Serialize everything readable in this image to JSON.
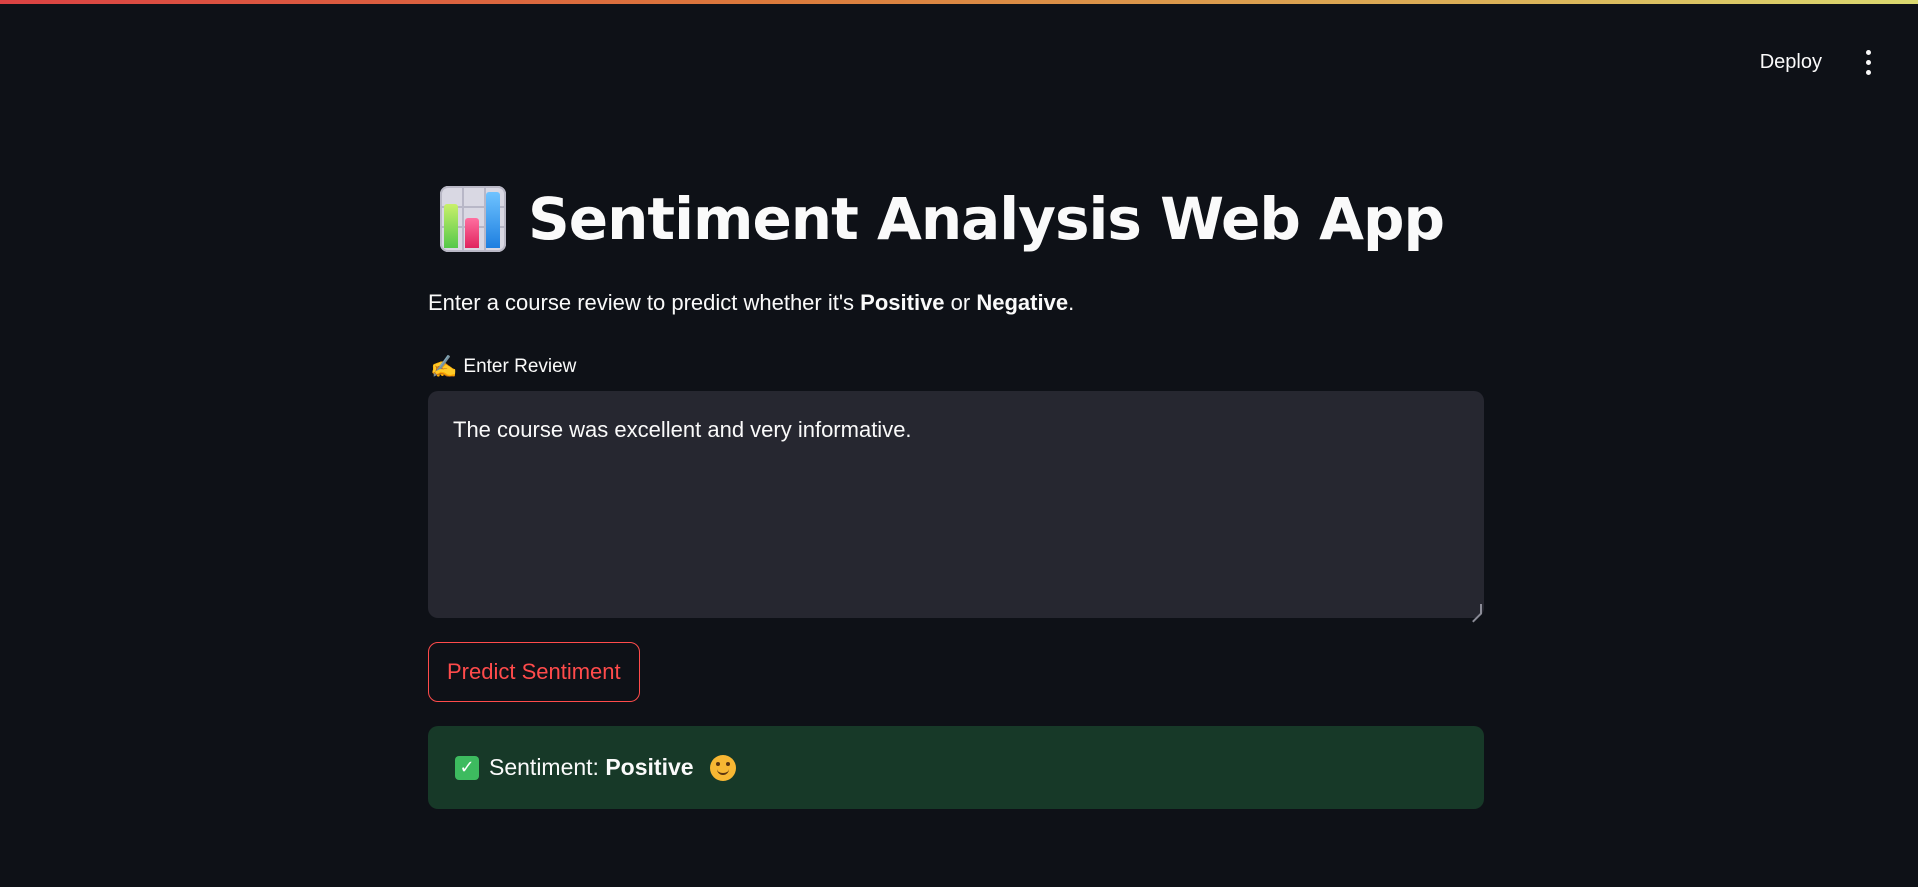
{
  "header": {
    "deploy_label": "Deploy",
    "menu_icon": "vertical-ellipsis-icon"
  },
  "main": {
    "title": "Sentiment Analysis Web App",
    "title_icon": "bar-chart-icon",
    "subtitle_prefix": "Enter a course review to predict whether it's ",
    "subtitle_positive": "Positive",
    "subtitle_or": " or ",
    "subtitle_negative": "Negative",
    "subtitle_suffix": ".",
    "review_label": "Enter Review",
    "review_label_icon": "writing-hand-icon",
    "review_value": "The course was excellent and very informative.",
    "predict_button_label": "Predict Sentiment",
    "result": {
      "prefix": "Sentiment: ",
      "value": "Positive",
      "status_icon": "check-mark-icon",
      "emoji_icon": "smiling-face-icon"
    }
  },
  "colors": {
    "background": "#0e1117",
    "accent": "#ff4b4b",
    "textarea_bg": "#262730",
    "success_bg": "#173928",
    "success_icon": "#3dbb5f"
  }
}
